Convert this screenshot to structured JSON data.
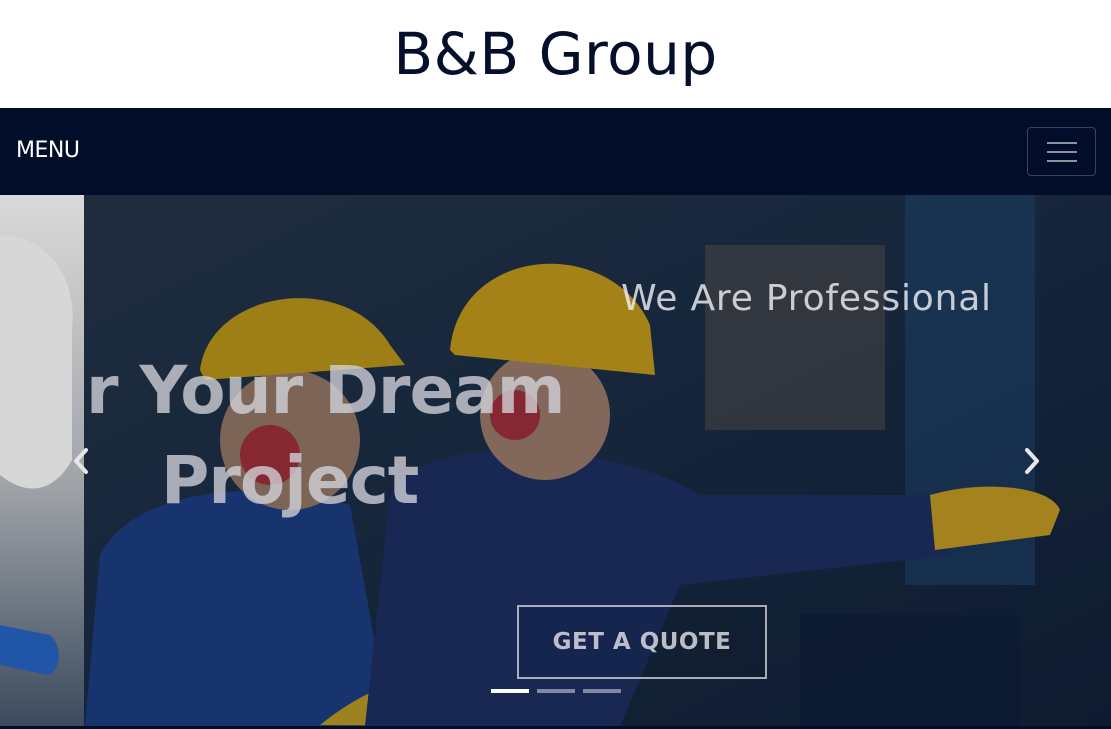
{
  "header": {
    "title": "B&B Group"
  },
  "navbar": {
    "menu_label": "MENU"
  },
  "hero": {
    "subtitle": "We Are Professional",
    "heading_line1": "r Your Dream",
    "heading_line2": "Project",
    "cta_label": "GET A QUOTE",
    "active_slide": 1,
    "slide_count": 3
  },
  "icons": {
    "hamburger": "hamburger-menu-icon",
    "prev": "chevron-left-icon",
    "next": "chevron-right-icon"
  },
  "colors": {
    "header_text": "#030f2b",
    "navbar_bg": "#020d2a",
    "hero_text": "#dcdce2"
  }
}
